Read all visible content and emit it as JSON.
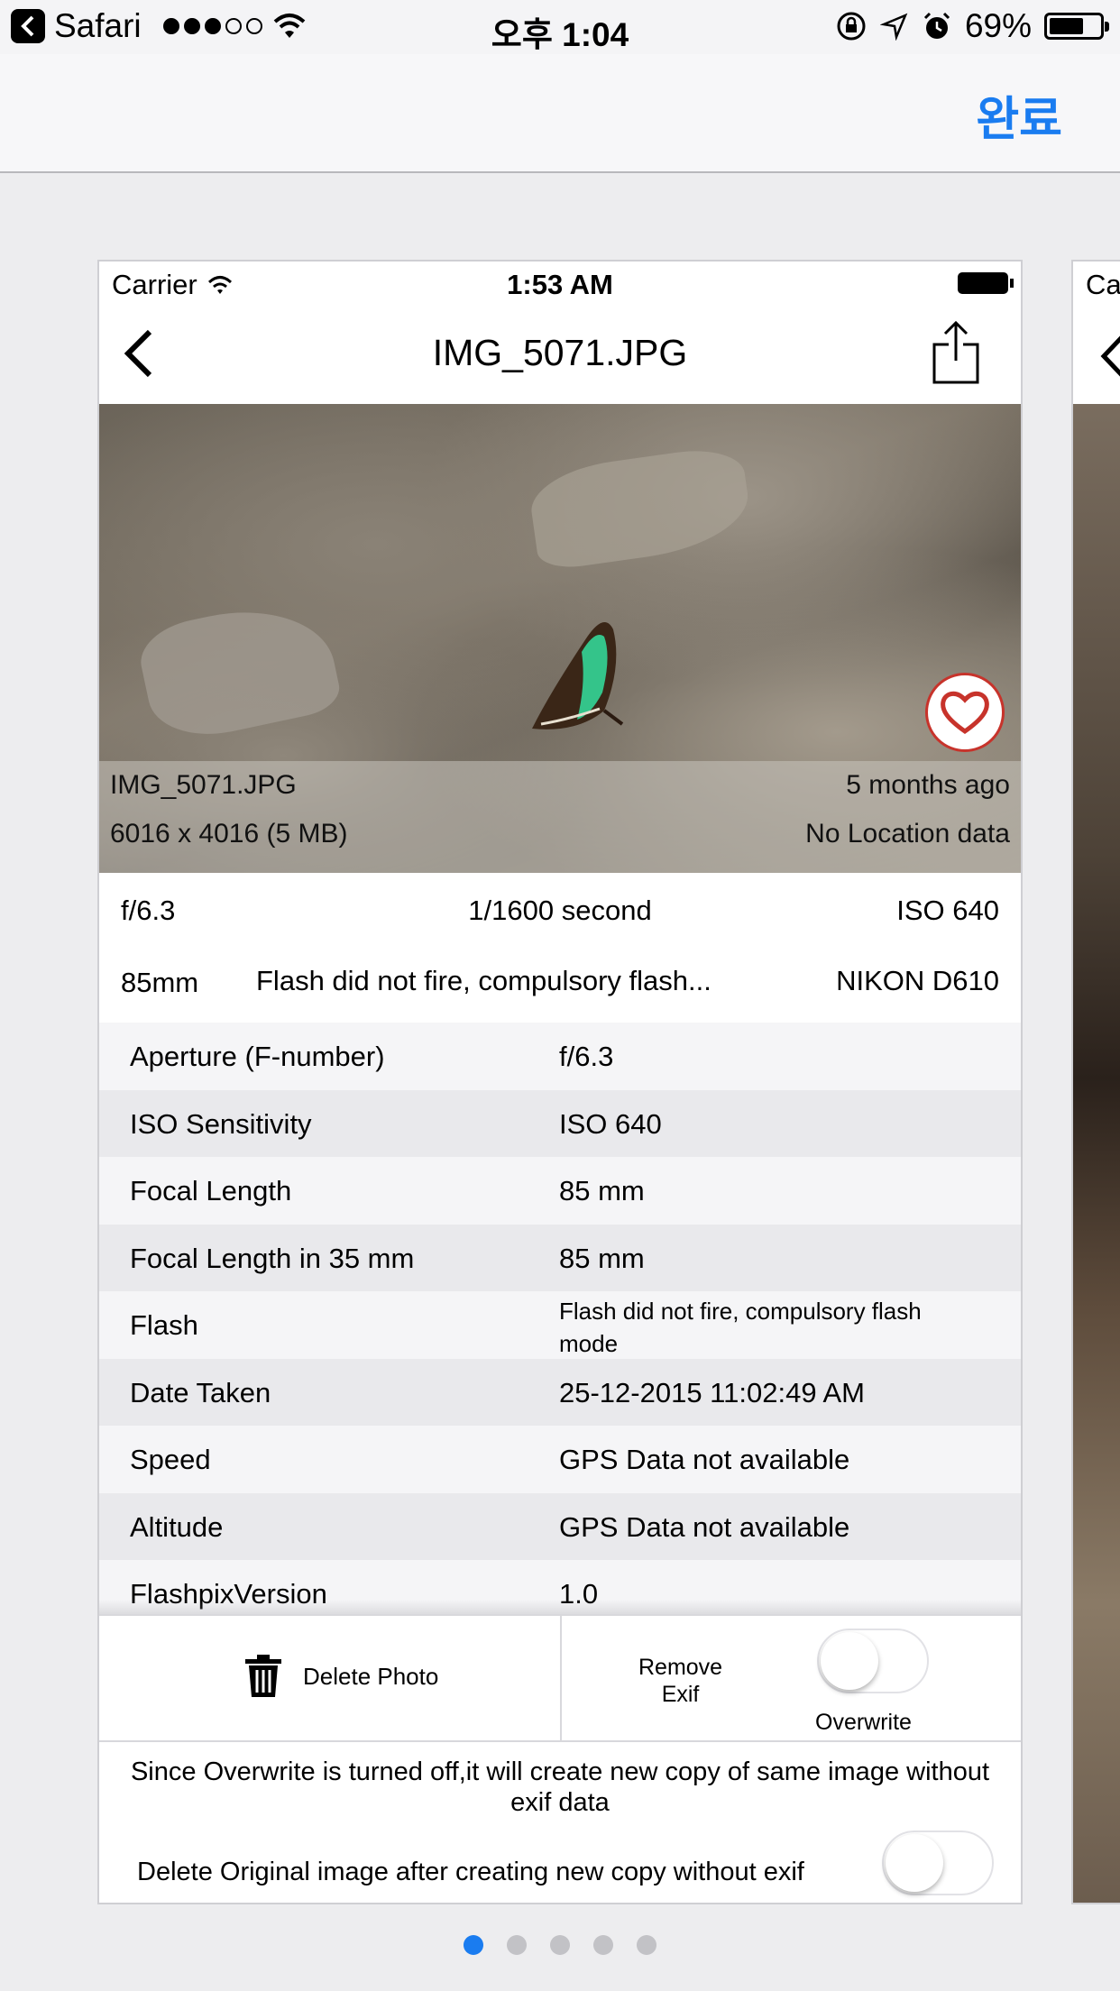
{
  "status_bar": {
    "back_app": "Safari",
    "time": "오후 1:04",
    "battery": "69%"
  },
  "outer_nav": {
    "done_label": "완료"
  },
  "card": {
    "inner_status": {
      "carrier": "Carrier",
      "time": "1:53 AM"
    },
    "title": "IMG_5071.JPG",
    "photo_overlay": {
      "filename": "IMG_5071.JPG",
      "age": "5 months ago",
      "dimensions": "6016 x 4016 (5 MB)",
      "location": "No Location data"
    },
    "summary": {
      "aperture": "f/6.3",
      "shutter": "1/1600 second",
      "iso": "ISO 640",
      "focal": "85mm",
      "flash": "Flash did not fire, compulsory flash...",
      "camera": "NIKON D610"
    },
    "exif_rows": [
      {
        "key": "Aperture (F-number)",
        "value": "f/6.3"
      },
      {
        "key": "ISO Sensitivity",
        "value": "ISO 640"
      },
      {
        "key": "Focal Length",
        "value": "85 mm"
      },
      {
        "key": "Focal Length in 35 mm",
        "value": "85 mm"
      },
      {
        "key": "Flash",
        "value": "Flash did not fire, compulsory flash mode"
      },
      {
        "key": "Date Taken",
        "value": "25-12-2015 11:02:49 AM"
      },
      {
        "key": "Speed",
        "value": "GPS Data not available"
      },
      {
        "key": "Altitude",
        "value": "GPS Data not available"
      },
      {
        "key": "FlashpixVersion",
        "value": "1.0"
      }
    ],
    "actions": {
      "delete_label": "Delete Photo",
      "remove_exif_line1": "Remove",
      "remove_exif_line2": "Exif",
      "overwrite_label": "Overwrite",
      "overwrite_on": false
    },
    "info": {
      "message": "Since Overwrite is turned off,it will create new copy of same image without exif data",
      "delete_original_label": "Delete Original image after creating new copy without exif",
      "delete_original_on": false
    }
  },
  "peek_card": {
    "carrier_partial": "Ca"
  },
  "pager": {
    "count": 5,
    "active_index": 0
  },
  "colors": {
    "accent": "#1a7cf0",
    "heart": "#c7332b"
  }
}
